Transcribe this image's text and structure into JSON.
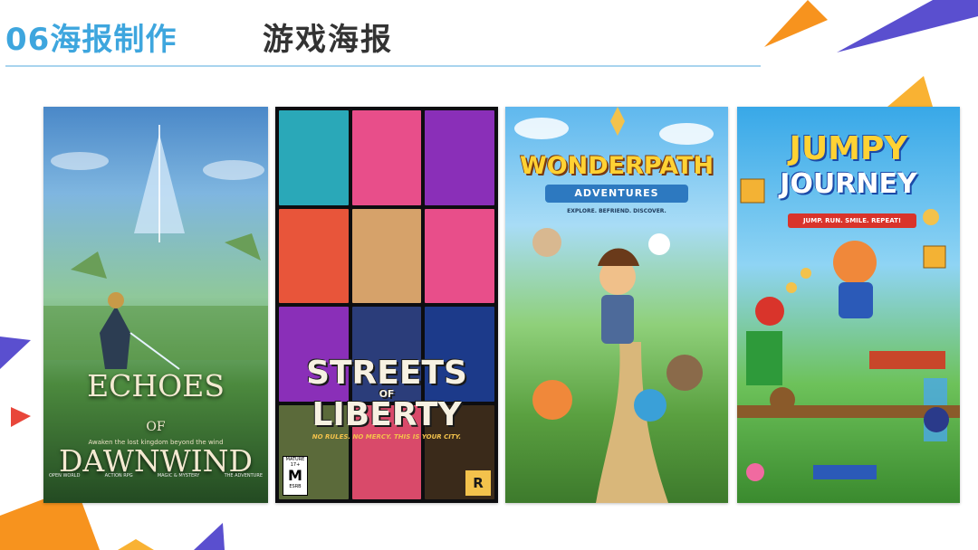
{
  "header": {
    "section_title": "06海报制作",
    "subtitle": "游戏海报"
  },
  "posters": [
    {
      "title_line1": "ECHOES",
      "title_line2": "OF",
      "title_line3": "DAWNWIND",
      "tagline": "Awaken the lost kingdom beyond the wind",
      "features": [
        "OPEN WORLD",
        "ACTION RPG",
        "MAGIC & MYSTERY",
        "THE ADVENTURE"
      ]
    },
    {
      "title_line1": "STREETS",
      "title_line2": "OF",
      "title_line3": "LIBERTY",
      "tagline": "NO RULES. NO MERCY. THIS IS YOUR CITY.",
      "rating_letter": "M",
      "rating_top": "MATURE 17+",
      "rating_bottom": "ESRB",
      "logo": "R"
    },
    {
      "title": "WONDERPATH",
      "banner": "ADVENTURES",
      "tagline": "EXPLORE. BEFRIEND. DISCOVER."
    },
    {
      "title_line1": "JUMPY",
      "title_line2": "JOURNEY",
      "banner": "JUMP. RUN. SMILE. REPEAT!"
    }
  ],
  "colors": {
    "accent": "#3ea6de",
    "orange": "#f7931e",
    "purple": "#5a4fcf"
  }
}
